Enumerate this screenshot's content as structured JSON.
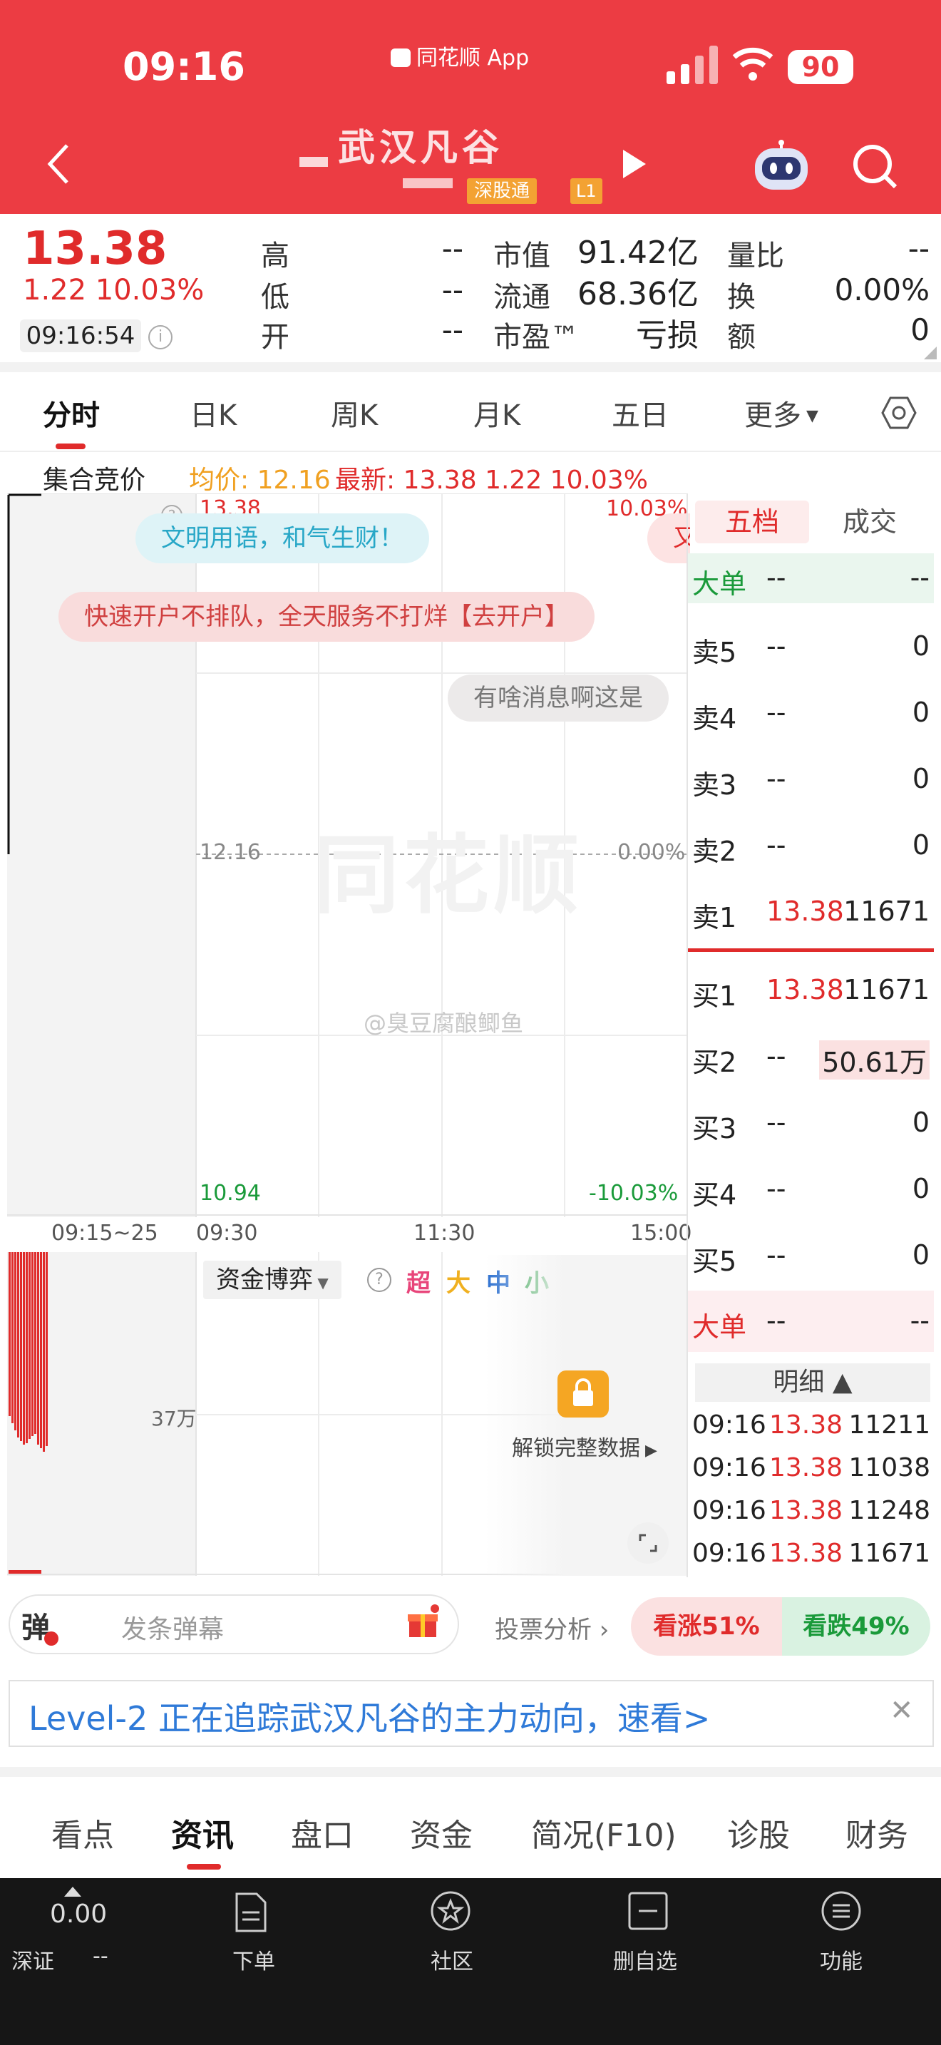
{
  "status_bar": {
    "time": "09:16",
    "app_label": "同花顺 App",
    "battery": "90"
  },
  "header": {
    "stock_name": "武汉凡谷",
    "exchange_badge": "深股通",
    "level_badge": "L1"
  },
  "quote": {
    "price": "13.38",
    "change": "1.22  10.03%",
    "time": "09:16:54",
    "fields": [
      {
        "label": "高",
        "value": "--"
      },
      {
        "label": "低",
        "value": "--"
      },
      {
        "label": "开",
        "value": "--"
      },
      {
        "label": "市值",
        "value": "91.42亿"
      },
      {
        "label": "流通",
        "value": "68.36亿"
      },
      {
        "label": "市盈™",
        "value": "亏损"
      },
      {
        "label": "量比",
        "value": "--"
      },
      {
        "label": "换",
        "value": "0.00%"
      },
      {
        "label": "额",
        "value": "0"
      }
    ]
  },
  "chart_tabs": [
    "分时",
    "日K",
    "周K",
    "月K",
    "五日",
    "更多"
  ],
  "auction_bar": {
    "label": "集合竞价",
    "avg": "均价: 12.16",
    "latest": "最新: 13.38  1.22  10.03%"
  },
  "chart": {
    "top_price": "13.38",
    "top_pct": "10.03%",
    "mid_price": "12.16",
    "mid_pct": "0.00%",
    "bottom_price": "10.94",
    "bottom_pct": "-10.03%",
    "x_labels": [
      "09:15~25",
      "09:30",
      "11:30",
      "15:00"
    ],
    "volume_label": "37万",
    "watermark": "同花顺",
    "weibo": "@臭豆腐酿鲫鱼"
  },
  "chart_data": {
    "type": "line",
    "title": "",
    "ylim": [
      10.94,
      13.38
    ],
    "y_ticks": [
      "10.94",
      "12.16",
      "13.38"
    ],
    "reference": 12.16,
    "x_ticks": [
      "09:15~25",
      "09:30",
      "11:30",
      "15:00"
    ],
    "series": [
      {
        "values": []
      }
    ]
  },
  "bubbles": {
    "b1": "文明用语，和气生财！",
    "b2": "快速开户不排队，全天服务不打烊【去开户】",
    "b3": "有啥消息啊这是",
    "b4": "又"
  },
  "order_book": {
    "tab_five": "五档",
    "tab_trades": "成交",
    "big_sell": {
      "label": "大单",
      "price": "--",
      "vol": "--"
    },
    "asks": [
      {
        "label": "卖5",
        "price": "--",
        "vol": "0"
      },
      {
        "label": "卖4",
        "price": "--",
        "vol": "0"
      },
      {
        "label": "卖3",
        "price": "--",
        "vol": "0"
      },
      {
        "label": "卖2",
        "price": "--",
        "vol": "0"
      },
      {
        "label": "卖1",
        "price": "13.38",
        "vol": "11671"
      }
    ],
    "bids": [
      {
        "label": "买1",
        "price": "13.38",
        "vol": "11671"
      },
      {
        "label": "买2",
        "price": "--",
        "vol": "50.61万"
      },
      {
        "label": "买3",
        "price": "--",
        "vol": "0"
      },
      {
        "label": "买4",
        "price": "--",
        "vol": "0"
      },
      {
        "label": "买5",
        "price": "--",
        "vol": "0"
      }
    ],
    "big_buy": {
      "label": "大单",
      "price": "--",
      "vol": "--"
    },
    "detail_label": "明细 ▲",
    "ticks": [
      {
        "time": "09:16",
        "price": "13.38",
        "vol": "11211"
      },
      {
        "time": "09:16",
        "price": "13.38",
        "vol": "11038"
      },
      {
        "time": "09:16",
        "price": "13.38",
        "vol": "11248"
      },
      {
        "time": "09:16",
        "price": "13.38",
        "vol": "11671"
      }
    ]
  },
  "fund_panel": {
    "dropdown": "资金博弈",
    "sizes": [
      "超",
      "大",
      "中",
      "小"
    ],
    "unlock": "解锁完整数据"
  },
  "danmu": {
    "icon": "弹",
    "placeholder": "发条弹幕",
    "vote_label": "投票分析",
    "up": "看涨51%",
    "down": "看跌49%"
  },
  "level2_banner": "Level-2 正在追踪武汉凡谷的主力动向，速看>",
  "bottom_tabs": [
    "看点",
    "资讯",
    "盘口",
    "资金",
    "简况(F10)",
    "诊股",
    "财务"
  ],
  "dark_bar": {
    "index_value": "0.00",
    "index_name": "深证",
    "index_change": "--",
    "items": [
      "下单",
      "社区",
      "删自选",
      "功能"
    ]
  },
  "colors": {
    "up": "#e02b2b",
    "down": "#1a9a3a",
    "header": "#ec3c43",
    "avg": "#f0a020"
  }
}
